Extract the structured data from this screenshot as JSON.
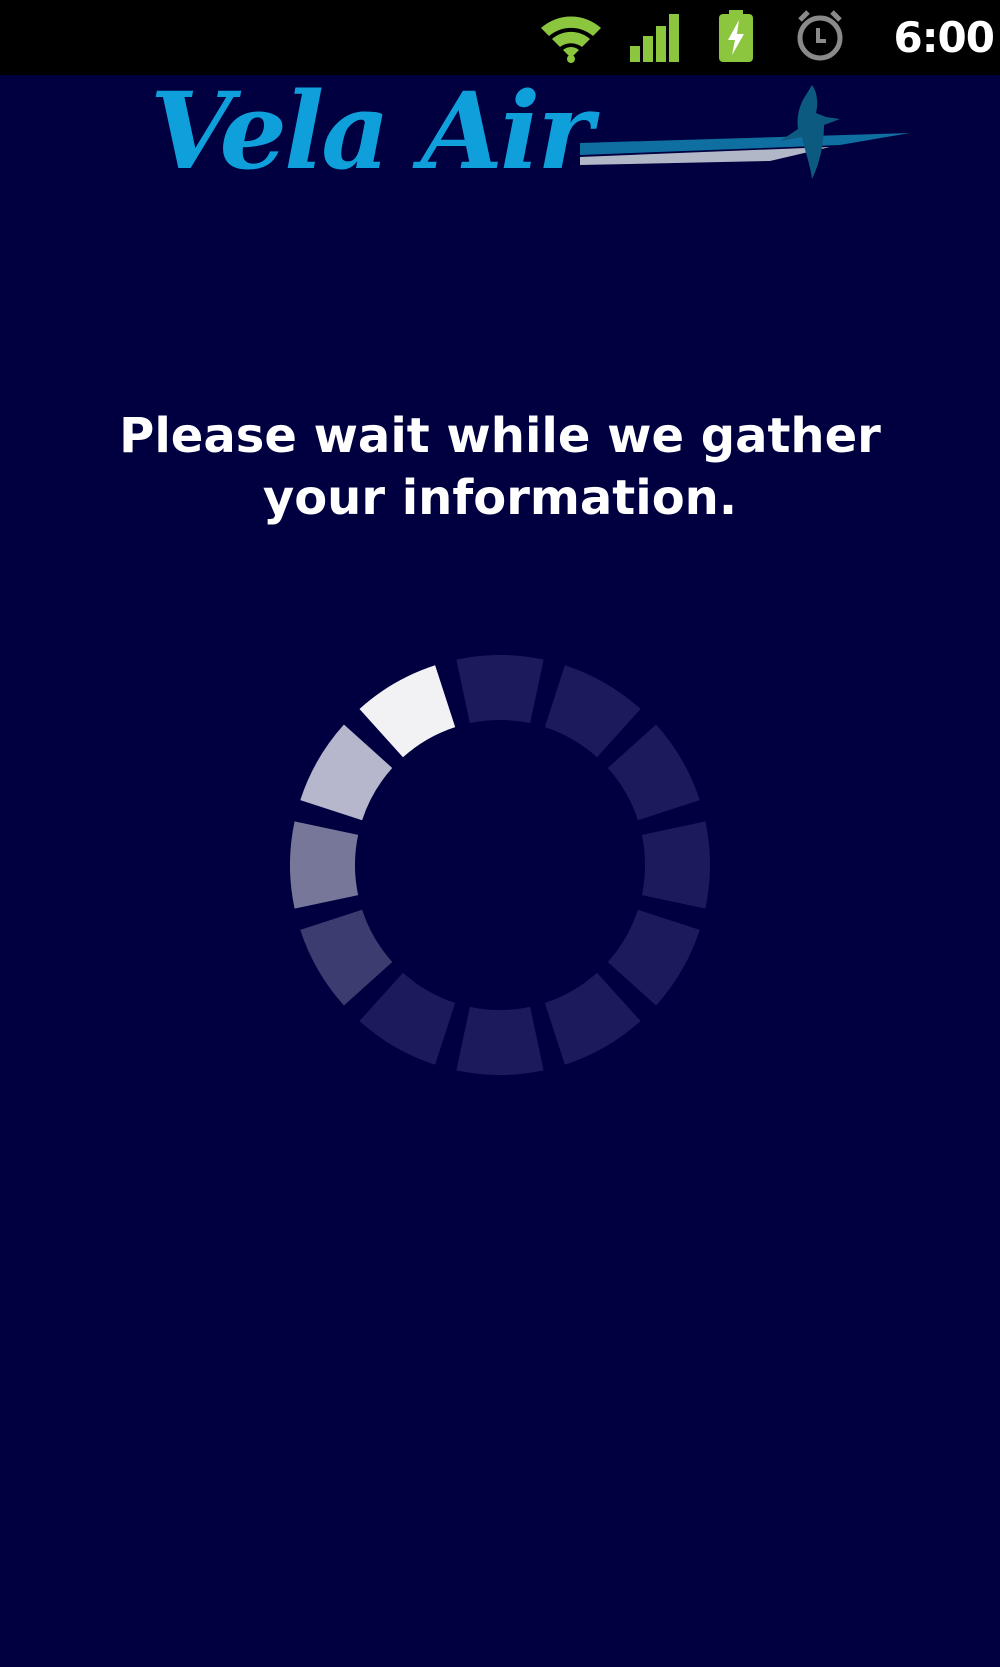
{
  "status_bar": {
    "time": "6:00",
    "icons": [
      "wifi-icon",
      "signal-icon",
      "battery-charging-icon",
      "alarm-icon"
    ],
    "icon_color": "#8cc63f"
  },
  "header": {
    "brand": "Vela Air",
    "brand_color": "#0fa0dc",
    "bird_color": "#0d5a80"
  },
  "loading": {
    "message": "Please wait while we gather your information.",
    "spinner_segments": 12,
    "spinner_active_color": "#f2f2f5",
    "spinner_inactive_color": "#1a1a5c"
  },
  "colors": {
    "background": "#000040",
    "status_bar": "#000000",
    "text": "#ffffff"
  }
}
